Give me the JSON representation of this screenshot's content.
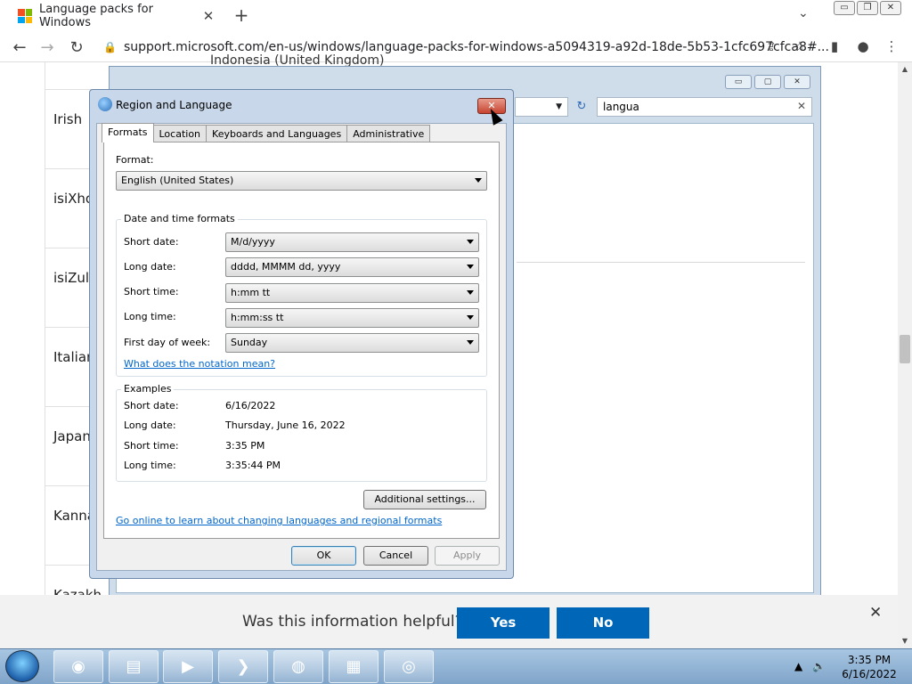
{
  "browser": {
    "tab_title": "Language packs for Windows",
    "tab_close": "✕",
    "new_tab": "+",
    "tab_chevron": "⌄",
    "url": "support.microsoft.com/en-us/windows/language-packs-for-windows-a5094319-a92d-18de-5b53-1cfc697cfca8#...",
    "window_buttons": [
      "▭",
      "❐",
      "✕"
    ],
    "favicon_colors": [
      "#f25022",
      "#7fba00",
      "#00a4ef",
      "#ffb900"
    ]
  },
  "page": {
    "top_partial_text": "Indonesia                (United Kingdom)",
    "languages": [
      "Irish",
      "isiXhosa",
      "isiZulu",
      "Italian",
      "Japanese",
      "Kannada",
      "Kazakh"
    ]
  },
  "control_panel": {
    "search_value": "langua",
    "search_clear": "✕",
    "dropdown_arrow": "▼",
    "refresh": "↻",
    "window_buttons": [
      "▭",
      "▢",
      "✕"
    ]
  },
  "dialog": {
    "title": "Region and Language",
    "close": "✕",
    "tabs": [
      "Formats",
      "Location",
      "Keyboards and Languages",
      "Administrative"
    ],
    "format_label": "Format:",
    "format_value": "English (United States)",
    "datetime_group": "Date and time formats",
    "fields": [
      {
        "label": "Short date:",
        "value": "M/d/yyyy"
      },
      {
        "label": "Long date:",
        "value": "dddd, MMMM dd, yyyy"
      },
      {
        "label": "Short time:",
        "value": "h:mm tt"
      },
      {
        "label": "Long time:",
        "value": "h:mm:ss tt"
      },
      {
        "label": "First day of week:",
        "value": "Sunday"
      }
    ],
    "notation_link": "What does the notation mean?",
    "examples_group": "Examples",
    "examples": [
      {
        "label": "Short date:",
        "value": "6/16/2022"
      },
      {
        "label": "Long date:",
        "value": "Thursday, June 16, 2022"
      },
      {
        "label": "Short time:",
        "value": "3:35 PM"
      },
      {
        "label": "Long time:",
        "value": "3:35:44 PM"
      }
    ],
    "additional_settings": "Additional settings...",
    "online_link": "Go online to learn about changing languages and regional formats",
    "ok": "OK",
    "cancel": "Cancel",
    "apply": "Apply"
  },
  "helpful": {
    "question": "Was this information helpful?",
    "yes": "Yes",
    "no": "No",
    "close": "✕"
  },
  "taskbar": {
    "time": "3:35 PM",
    "date": "6/16/2022"
  }
}
